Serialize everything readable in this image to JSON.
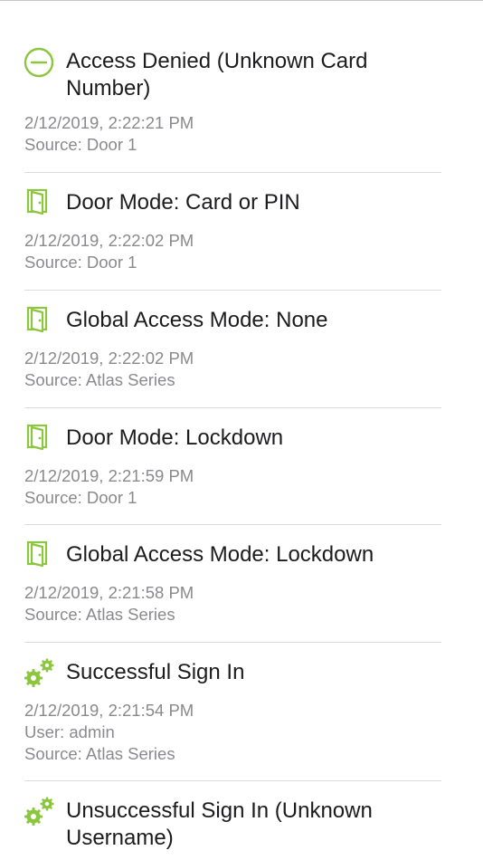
{
  "events": [
    {
      "icon": "access-denied-icon",
      "title_line1": "Access Denied (Unknown Card",
      "title_line2": "Number)",
      "timestamp": "2/12/2019, 2:22:21 PM",
      "source": "Source: Door 1"
    },
    {
      "icon": "door-icon",
      "title": "Door Mode: Card or PIN",
      "timestamp": "2/12/2019, 2:22:02 PM",
      "source": "Source: Door 1"
    },
    {
      "icon": "door-icon",
      "title": "Global Access Mode: None",
      "timestamp": "2/12/2019, 2:22:02 PM",
      "source": "Source: Atlas Series"
    },
    {
      "icon": "door-icon",
      "title": "Door Mode: Lockdown",
      "timestamp": "2/12/2019, 2:21:59 PM",
      "source": "Source: Door 1"
    },
    {
      "icon": "door-icon",
      "title": "Global Access Mode: Lockdown",
      "timestamp": "2/12/2019, 2:21:58 PM",
      "source": "Source: Atlas Series"
    },
    {
      "icon": "gears-icon",
      "title": "Successful Sign In",
      "timestamp": "2/12/2019, 2:21:54 PM",
      "user": "User: admin",
      "source": "Source: Atlas Series"
    },
    {
      "icon": "gears-icon",
      "title_line1": "Unsuccessful Sign In (Unknown",
      "title_line2": "Username)"
    }
  ],
  "colors": {
    "icon_green": "#8cc63f",
    "title_text": "#1c1c1e",
    "meta_text": "#8a8a8e",
    "separator": "#dcdce0"
  }
}
